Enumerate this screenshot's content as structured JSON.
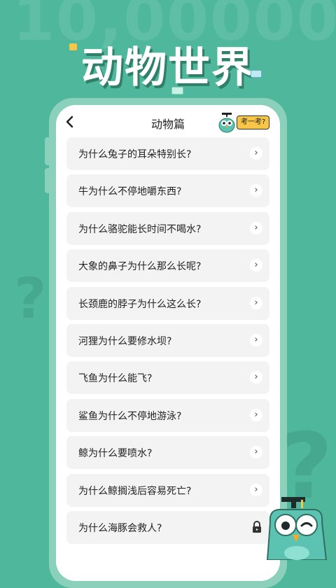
{
  "background": {
    "number_text": "10,00000",
    "question_mark": "?",
    "color": "#4fb79c"
  },
  "title": "动物世界",
  "header": {
    "back_icon": "chevron-left-icon",
    "title": "动物篇",
    "quiz_label": "考一考?"
  },
  "questions": [
    {
      "text": "为什么兔子的耳朵特别长?",
      "locked": false
    },
    {
      "text": "牛为什么不停地嚼东西?",
      "locked": false
    },
    {
      "text": "为什么骆驼能长时间不喝水?",
      "locked": false
    },
    {
      "text": "大象的鼻子为什么那么长呢?",
      "locked": false
    },
    {
      "text": "长颈鹿的脖子为什么这么长?",
      "locked": false
    },
    {
      "text": "河狸为什么要修水坝?",
      "locked": false
    },
    {
      "text": "飞鱼为什么能飞?",
      "locked": false
    },
    {
      "text": "鲨鱼为什么不停地游泳?",
      "locked": false
    },
    {
      "text": "鲸为什么要喷水?",
      "locked": false
    },
    {
      "text": "为什么鲸搁浅后容易死亡?",
      "locked": false
    },
    {
      "text": "为什么海豚会救人?",
      "locked": true
    }
  ],
  "icons": {
    "item_open": "chevron-right-icon",
    "item_locked": "lock-icon",
    "mascot": "owl-mascot-icon"
  },
  "colors": {
    "accent_yellow": "#f7c548",
    "owl_teal": "#5cc3b3",
    "item_bg": "#f3f3f3"
  }
}
